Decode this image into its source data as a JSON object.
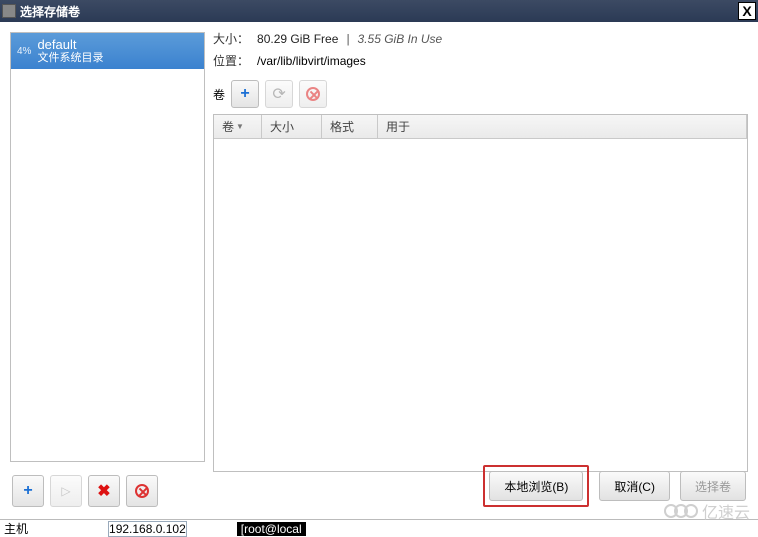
{
  "window": {
    "title": "选择存储卷",
    "close_glyph": "X"
  },
  "sidebar": {
    "pools": [
      {
        "percent": "4%",
        "name": "default",
        "subtitle": "文件系统目录"
      }
    ]
  },
  "details": {
    "size_label": "大小：",
    "free": "80.29 GiB Free",
    "sep": "|",
    "inuse": "3.55 GiB In Use",
    "location_label": "位置：",
    "location_value": "/var/lib/libvirt/images",
    "volume_label": "卷"
  },
  "columns": {
    "name": "卷",
    "size": "大小",
    "format": "格式",
    "used": "用于"
  },
  "icons": {
    "plus": "+",
    "refresh": "⟳",
    "play": "▷",
    "x": "✖",
    "sort": "▼"
  },
  "buttons": {
    "local_browse": "本地浏览(B)",
    "cancel": "取消(C)",
    "select_volume": "选择卷"
  },
  "status": {
    "host_label": "主机",
    "ip": "192.168.0.102",
    "term": "[root@local"
  },
  "watermark": "亿速云"
}
